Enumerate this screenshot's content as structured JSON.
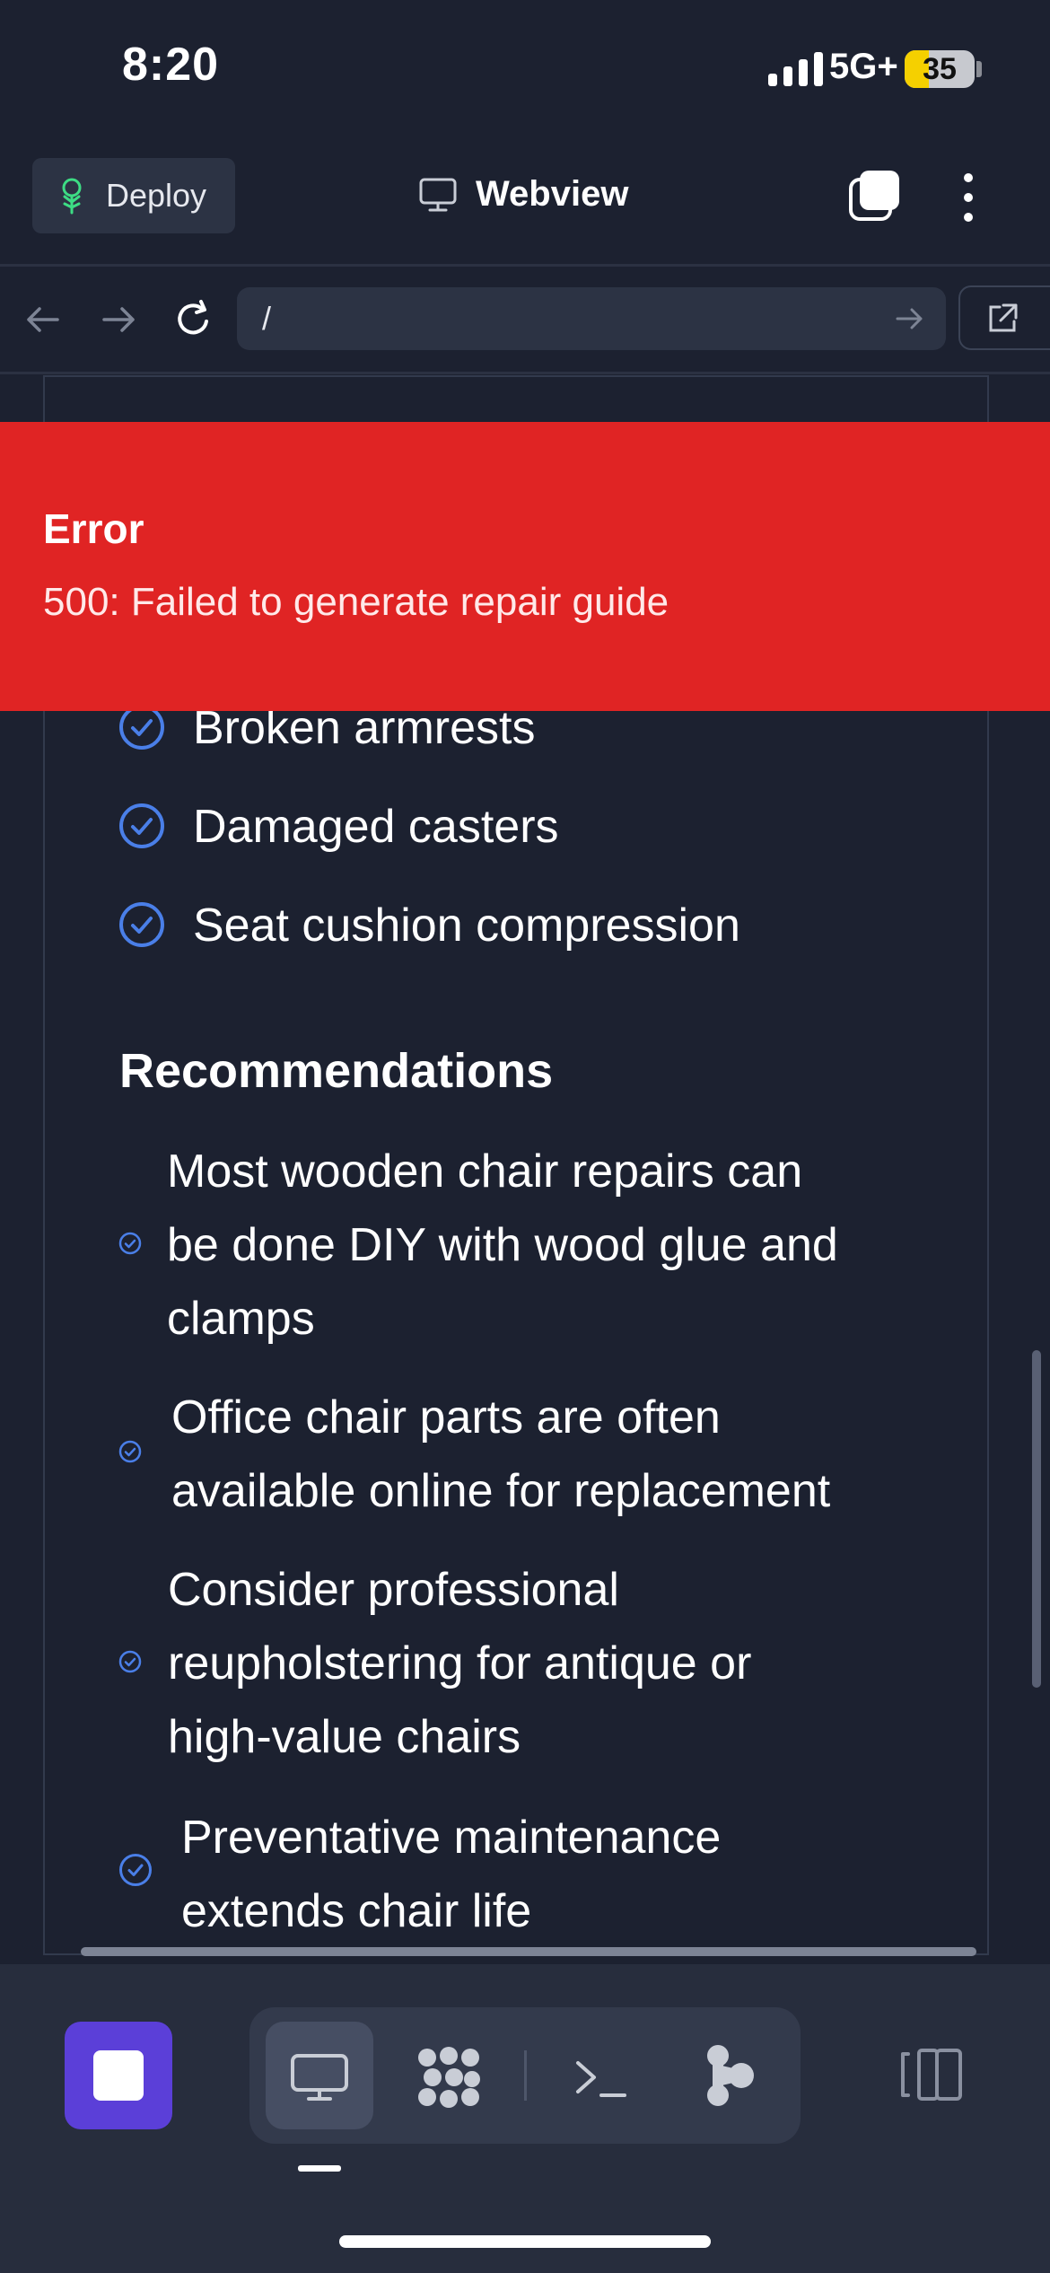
{
  "status_bar": {
    "time": "8:20",
    "network": "5G+",
    "battery": "35",
    "battery_level": 0.35
  },
  "top_bar": {
    "deploy_label": "Deploy",
    "title": "Webview"
  },
  "url_bar": {
    "path": "/"
  },
  "error": {
    "title": "Error",
    "message": "500: Failed to generate repair guide"
  },
  "issues": [
    "Broken armrests",
    "Damaged casters",
    "Seat cushion compression"
  ],
  "recommendations": {
    "title": "Recommendations",
    "items": [
      [
        "Most wooden chair repairs can",
        "be done DIY with wood glue and",
        "clamps"
      ],
      [
        "Office chair parts are often",
        "available online for replacement"
      ],
      [
        "Consider professional",
        "reupholstering for antique or",
        "high-value chairs"
      ],
      [
        "Preventative maintenance",
        "extends chair life"
      ]
    ]
  },
  "colors": {
    "accent": "#4a7fe8",
    "error": "#e02424",
    "stop": "#5b3fd8",
    "background": "#1c2130"
  },
  "icons": [
    "deploy-icon",
    "monitor-icon",
    "tabs-icon",
    "more-icon",
    "back-icon",
    "forward-icon",
    "reload-icon",
    "go-arrow-icon",
    "open-external-icon",
    "check-circle-icon",
    "stop-icon",
    "webview-tab-icon",
    "grid-tab-icon",
    "terminal-tab-icon",
    "git-tab-icon",
    "split-view-icon"
  ]
}
